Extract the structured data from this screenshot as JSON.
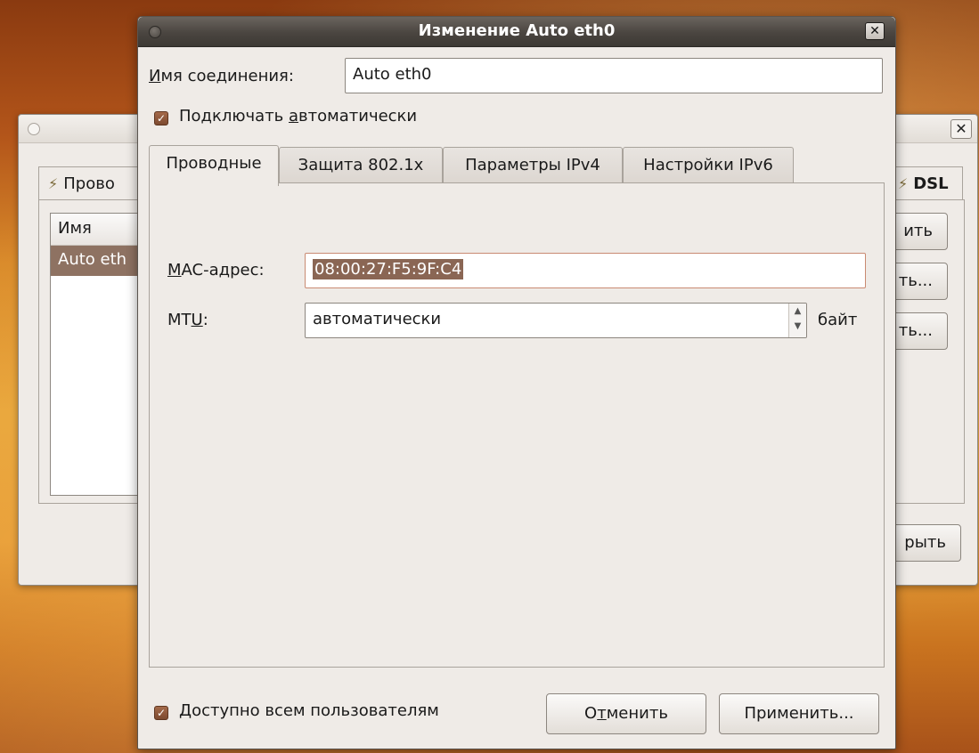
{
  "background_window": {
    "tab_left_label": "Прово",
    "tab_right_label": "DSL",
    "list_header": "Имя",
    "list_row": "Auto eth",
    "buttons": [
      "ить",
      "ть...",
      "ть..."
    ],
    "close_button_label": "рыть"
  },
  "dialog": {
    "title": "Изменение Auto eth0",
    "connection_name_label_first": "И",
    "connection_name_label_rest": "мя соединения:",
    "connection_name_value": "Auto eth0",
    "auto_connect_label_pre": "Подключать ",
    "auto_connect_label_mn": "а",
    "auto_connect_label_post": "втоматически",
    "auto_connect_checked": true,
    "tabs": [
      {
        "label": "Проводные",
        "active": true
      },
      {
        "label": "Защита 802.1x",
        "active": false
      },
      {
        "label": "Параметры IPv4",
        "active": false
      },
      {
        "label": "Настройки IPv6",
        "active": false
      }
    ],
    "mac_label_first": "М",
    "mac_label_rest": "AC-адрес:",
    "mac_value": "08:00:27:F5:9F:C4",
    "mtu_label_pre": "MT",
    "mtu_label_mn": "U",
    "mtu_label_post": ":",
    "mtu_value": "автоматически",
    "mtu_unit": "байт",
    "all_users_label": "Доступно всем пользователям",
    "all_users_checked": true,
    "cancel_pre": "О",
    "cancel_mn": "т",
    "cancel_post": "менить",
    "apply_label": "Применить..."
  },
  "colors": {
    "titlebar": "#4a4540",
    "selection": "#8a6654",
    "window_bg": "#efebe7"
  }
}
